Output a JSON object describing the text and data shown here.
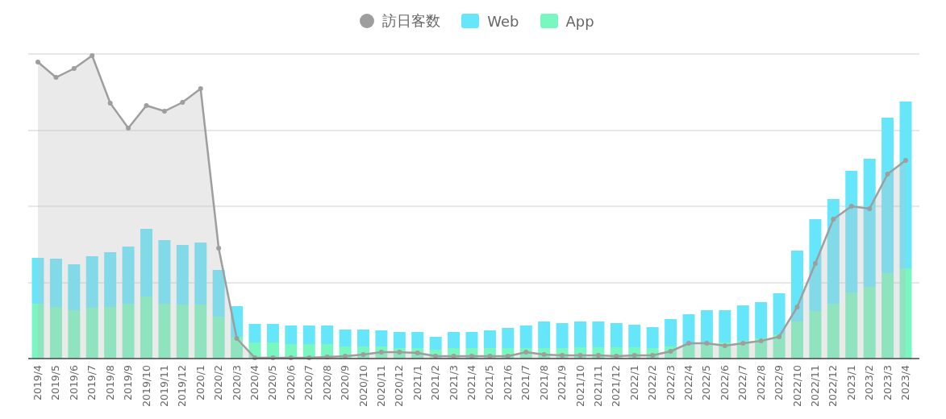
{
  "legend": [
    {
      "label": "訪日客数",
      "kind": "line",
      "color": "#9e9e9e"
    },
    {
      "label": "Web",
      "kind": "bar",
      "color": "#66e6fb"
    },
    {
      "label": "App",
      "kind": "bar",
      "color": "#79f7c0"
    }
  ],
  "chart": {
    "categories": [
      "2019/4",
      "2019/5",
      "2019/6",
      "2019/7",
      "2019/8",
      "2019/9",
      "2019/10",
      "2019/11",
      "2019/12",
      "2020/1",
      "2020/2",
      "2020/3",
      "2020/4",
      "2020/5",
      "2020/6",
      "2020/7",
      "2020/8",
      "2020/9",
      "2020/10",
      "2020/11",
      "2020/12",
      "2021/1",
      "2021/2",
      "2021/3",
      "2021/4",
      "2021/5",
      "2021/6",
      "2021/7",
      "2021/8",
      "2021/9",
      "2021/10",
      "2021/11",
      "2021/12",
      "2022/1",
      "2022/2",
      "2022/3",
      "2022/4",
      "2022/5",
      "2022/6",
      "2022/7",
      "2022/8",
      "2022/9",
      "2022/10",
      "2022/11",
      "2022/12",
      "2023/1",
      "2023/2",
      "2023/3",
      "2023/4"
    ]
  }
}
